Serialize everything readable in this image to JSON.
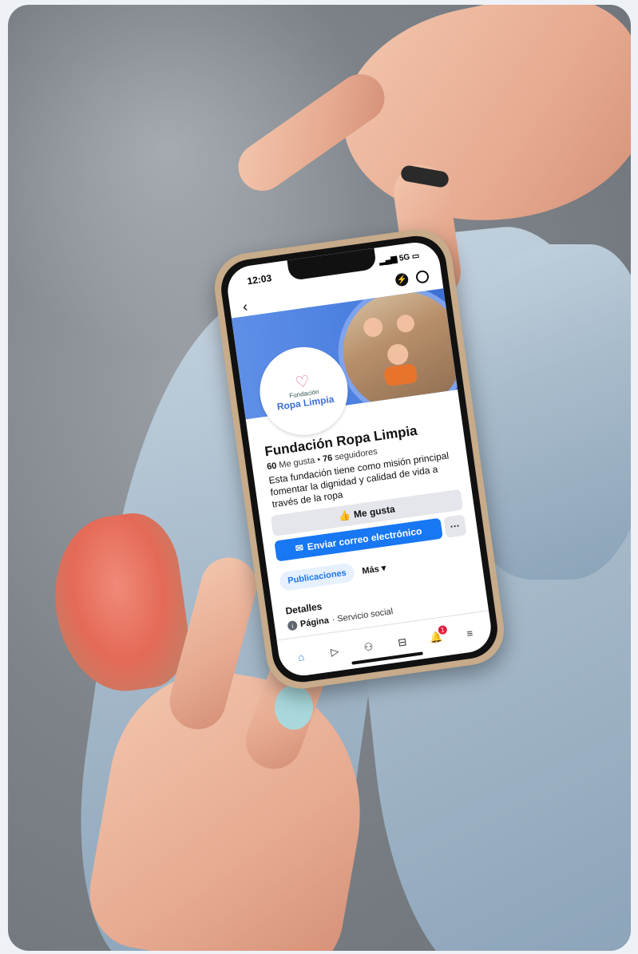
{
  "status_bar": {
    "time": "12:03",
    "network": "5G"
  },
  "logo": {
    "small": "Fundación",
    "big": "Ropa Limpia"
  },
  "page": {
    "name": "Fundación Ropa Limpia",
    "likes_count": "60",
    "likes_label": "Me gusta",
    "followers_count": "76",
    "followers_label": "seguidores",
    "description": "Esta fundación tiene como misión principal fomentar la dignidad y calidad de vida a través de la ropa"
  },
  "actions": {
    "like_label": "Me gusta",
    "email_label": "Enviar correo electrónico",
    "more_label": "···"
  },
  "tabs": {
    "posts": "Publicaciones",
    "more": "Más ▾"
  },
  "details": {
    "heading": "Detalles",
    "page_label": "Página",
    "category": "· Servicio social"
  },
  "notifications_badge": "1",
  "colors": {
    "brand_blue": "#1877f2",
    "cover_blue": "#4a7fe0",
    "nail_color": "#a8d8dc"
  }
}
